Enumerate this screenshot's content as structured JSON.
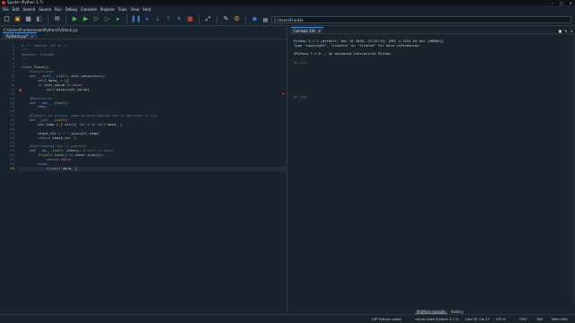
{
  "window": {
    "title": "Spyder (Python 3.7)",
    "controls": [
      "–",
      "□",
      "✕"
    ]
  },
  "menu": [
    "File",
    "Edit",
    "Search",
    "Source",
    "Run",
    "Debug",
    "Consoles",
    "Projects",
    "Tools",
    "View",
    "Help"
  ],
  "toolbar": {
    "icons": [
      {
        "name": "new-file-icon",
        "glyph": "▢",
        "color": "#e8e8e8"
      },
      {
        "name": "open-file-icon",
        "glyph": "▣",
        "color": "#d9a441"
      },
      {
        "name": "save-icon",
        "glyph": "■",
        "color": "#7a8ea0"
      },
      {
        "name": "save-all-icon",
        "glyph": "◧",
        "color": "#7a8ea0"
      },
      {
        "name": "sep"
      },
      {
        "name": "email-icon",
        "glyph": "✉",
        "color": "#c8ccd0"
      },
      {
        "name": "sep"
      },
      {
        "name": "run-icon",
        "glyph": "▶",
        "color": "#3dbf3d"
      },
      {
        "name": "run-file-icon",
        "glyph": "▶",
        "color": "#3dbf3d"
      },
      {
        "name": "run-cell-icon",
        "glyph": "▷",
        "color": "#3dbf3d"
      },
      {
        "name": "run-cell-advance-icon",
        "glyph": "▷",
        "color": "#3dbf3d"
      },
      {
        "name": "run-selection-icon",
        "glyph": "▸",
        "color": "#3dbf3d"
      },
      {
        "name": "sep"
      },
      {
        "name": "debug-icon",
        "glyph": "❚❚",
        "color": "#3a7bd5"
      },
      {
        "name": "step-icon",
        "glyph": "↳",
        "color": "#3a7bd5"
      },
      {
        "name": "step-into-icon",
        "glyph": "⇣",
        "color": "#3a7bd5"
      },
      {
        "name": "step-return-icon",
        "glyph": "⇡",
        "color": "#3a7bd5"
      },
      {
        "name": "continue-icon",
        "glyph": "⏵",
        "color": "#3a7bd5"
      },
      {
        "name": "stop-debug-icon",
        "glyph": "■",
        "color": "#d03030"
      },
      {
        "name": "sep"
      },
      {
        "name": "maximize-pane-icon",
        "glyph": "⤢",
        "color": "#c8ccd0"
      },
      {
        "name": "sep"
      },
      {
        "name": "preferences-icon",
        "glyph": "✎",
        "color": "#c8ccd0"
      },
      {
        "name": "python-path-icon",
        "glyph": "⚙",
        "color": "#d9a441"
      },
      {
        "name": "sep"
      },
      {
        "name": "python-logo-icon",
        "glyph": "◆",
        "color": "#3a7bd5"
      }
    ]
  },
  "path": {
    "value": "C:\\Users\\Frankie"
  },
  "editor": {
    "breadcrumb": "C:\\Users\\Frankie\\code\\Python\\PyStack.py",
    "tab_label": "PyStack.py*",
    "tab_close": "✕",
    "current_line": 29,
    "lines": [
      {
        "n": 1,
        "html": "<span class=\"c\"># -*- coding: utf-8 -*-</span>"
      },
      {
        "n": 2,
        "html": "<span class=\"c\">\"\"\"</span>"
      },
      {
        "n": 3,
        "html": "<span class=\"c\">@author: FrankBz</span>"
      },
      {
        "n": 4,
        "html": "<span class=\"c\">\"\"\"</span>"
      },
      {
        "n": 5,
        "html": ""
      },
      {
        "n": 6,
        "html": "<span class=\"k\">class</span> <span class=\"n\">Stack</span>():"
      },
      {
        "n": 7,
        "html": "    <span class=\"c\">#Constructor</span>"
      },
      {
        "n": 8,
        "html": "    <span class=\"k\">def</span> <span class=\"f\">__init__</span> (<span class=\"self\">self</span>, init_value=<span class=\"k\">None</span>):"
      },
      {
        "n": 9,
        "html": "        <span class=\"self\">self</span>.data_ = []"
      },
      {
        "n": 10,
        "html": "        <span class=\"k\">if</span> init_value != <span class=\"k\">None</span>:"
      },
      {
        "n": 11,
        "html": "            <span class=\"self\">self</span>.push(init_value)",
        "marker": true
      },
      {
        "n": 12,
        "html": ""
      },
      {
        "n": 13,
        "html": "    <span class=\"c\">#Destructor</span>"
      },
      {
        "n": 14,
        "html": "    <span class=\"k\">def</span> <span class=\"f\">__del__</span> (<span class=\"self\">self</span>):"
      },
      {
        "n": 15,
        "html": "        <span class=\"k\">pass</span>"
      },
      {
        "n": 16,
        "html": ""
      },
      {
        "n": 17,
        "html": "    <span class=\"c\">#Convert to string, same as overloading the << operator in C++</span>"
      },
      {
        "n": 18,
        "html": "    <span class=\"k\">def</span> <span class=\"f\">__str__</span> (<span class=\"self\">self</span>):"
      },
      {
        "n": 19,
        "html": "        str_temp = [ str(i) <span class=\"k\">for</span> i <span class=\"k\">in</span> <span class=\"self\">self</span>.data_ ]"
      },
      {
        "n": 20,
        "html": ""
      },
      {
        "n": 21,
        "html": "        stack_str = <span class=\"s\">\" \"</span>.join(str_temp)"
      },
      {
        "n": 22,
        "html": "        <span class=\"k\">return</span> stack_str  ▏"
      },
      {
        "n": 23,
        "html": ""
      },
      {
        "n": 24,
        "html": "    <span class=\"c\">#Overloading the == operator</span>"
      },
      {
        "n": 25,
        "html": "    <span class=\"k\">def</span> <span class=\"f\">__eq__</span> (<span class=\"self\">self</span>, other): <span class=\"c\"># self == other</span>"
      },
      {
        "n": 26,
        "html": "        <span class=\"k\">if</span>(<span class=\"self\">self</span>.size() != other.size()):"
      },
      {
        "n": 27,
        "html": "            <span class=\"k\">return</span> <span class=\"k\">False</span>"
      },
      {
        "n": 28,
        "html": "        <span class=\"k\">else</span>:"
      },
      {
        "n": 29,
        "html": "            <span class=\"k\">if</span>(<span class=\"self\">self</span>.data_ )"
      }
    ]
  },
  "console": {
    "tab_label": "Console 1/A",
    "tab_close": "✕",
    "icons": [
      "■",
      "✎",
      "≡"
    ],
    "output": [
      "Python 3.7.1 (default, Dec 10 2018, 22:54:23) [MSC v.1915 64 bit (AMD64)]",
      "Type \"copyright\", \"credits\" or \"license\" for more information.",
      "",
      "IPython 7.2.0 -- An enhanced Interactive Python.",
      "",
      "In [1]:",
      "",
      "",
      "",
      "",
      "",
      "",
      "",
      "In [1]:"
    ],
    "prompt_lines": [
      5,
      13
    ]
  },
  "bottom_tabs": [
    "IPython console",
    "History"
  ],
  "status": {
    "lsp": "LSP Python: ready",
    "conda": "conda: base (Python 3.7.1)",
    "position": "Line 29, Col 27",
    "encoding": "UTF-8",
    "eol": "CRLF",
    "mode": "RW",
    "memory": "Mem 58%"
  }
}
